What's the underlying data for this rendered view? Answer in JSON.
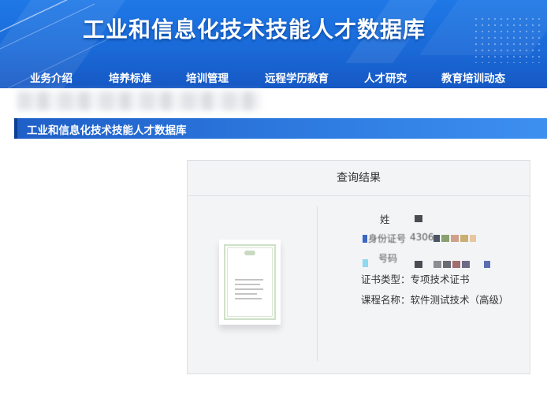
{
  "header": {
    "site_title": "工业和信息化技术技能人才数据库",
    "nav": [
      {
        "label": "业务介绍"
      },
      {
        "label": "培养标准"
      },
      {
        "label": "培训管理"
      },
      {
        "label": "远程学历教育"
      },
      {
        "label": "人才研究"
      },
      {
        "label": "教育培训动态"
      }
    ]
  },
  "section_bar": {
    "title": "工业和信息化技术技能人才数据库"
  },
  "result": {
    "title": "查询结果",
    "name_label": "姓",
    "id_label": "身份证号",
    "id_prefix": "4306",
    "cert_no_label": "号码",
    "cert_type_label": "证书类型：",
    "cert_type_value": "专项技术证书",
    "course_label": "课程名称：",
    "course_value": "软件测试技术（高级）"
  },
  "colors": {
    "banner": "#1a6ad8",
    "section_bar": "#2f7de2",
    "panel_bg": "#f3f4f6"
  }
}
